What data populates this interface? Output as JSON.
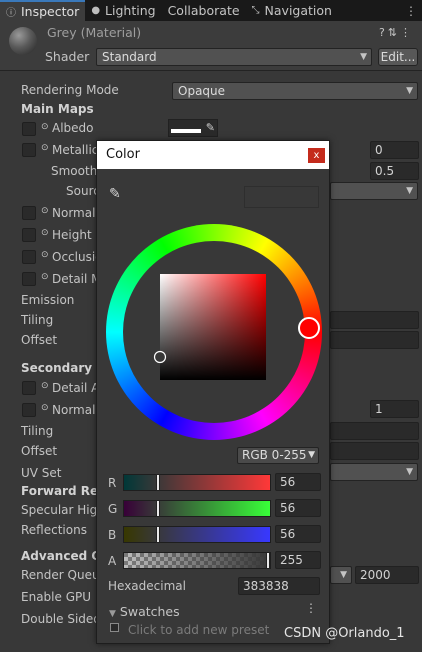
{
  "tabs": [
    {
      "label": "Inspector",
      "icon": "info-icon"
    },
    {
      "label": "Lighting",
      "icon": "bulb-icon"
    },
    {
      "label": "Collaborate",
      "icon": ""
    },
    {
      "label": "Navigation",
      "icon": "navigation-icon"
    }
  ],
  "header": {
    "material_name": "Grey (Material)",
    "shader_label": "Shader",
    "shader_value": "Standard",
    "edit_button": "Edit..."
  },
  "properties": {
    "rendering_mode_label": "Rendering Mode",
    "rendering_mode_value": "Opaque",
    "main_maps": "Main Maps",
    "albedo": "Albedo",
    "metallic": "Metallic",
    "metallic_value": "0",
    "smoothness": "Smoothn",
    "smoothness_value": "0.5",
    "source": "Sourc",
    "normal_map": "Normal M",
    "height_map": "Height M",
    "occlusion": "Occlusio",
    "detail_mask": "Detail M",
    "emission": "Emission",
    "tiling": "Tiling",
    "offset": "Offset",
    "secondary_maps": "Secondary M",
    "detail_albedo": "Detail Al",
    "normal_map2": "Normal M",
    "normal_map2_value": "1",
    "tiling2": "Tiling",
    "offset2": "Offset",
    "uv_set": "UV Set",
    "forward_rendering": "Forward Rend",
    "specular_highlights": "Specular High",
    "reflections": "Reflections",
    "advanced_options": "Advanced Op",
    "render_queue": "Render Queue",
    "render_queue_value": "2000",
    "enable_gpu": "Enable GPU In",
    "double_sided": "Double Sided"
  },
  "color_picker": {
    "title": "Color",
    "close": "x",
    "mode": "RGB 0-255",
    "r_label": "R",
    "r_value": "56",
    "g_label": "G",
    "g_value": "56",
    "b_label": "B",
    "b_value": "56",
    "a_label": "A",
    "a_value": "255",
    "hex_label": "Hexadecimal",
    "hex_value": "383838",
    "swatches_label": "Swatches",
    "swatches_hint": "Click to add new preset",
    "current_color": "#383838"
  },
  "watermark": "CSDN @Orlando_1",
  "colors": {
    "accent_tab": "#3a79bb",
    "close_red": "#c42b1c"
  }
}
